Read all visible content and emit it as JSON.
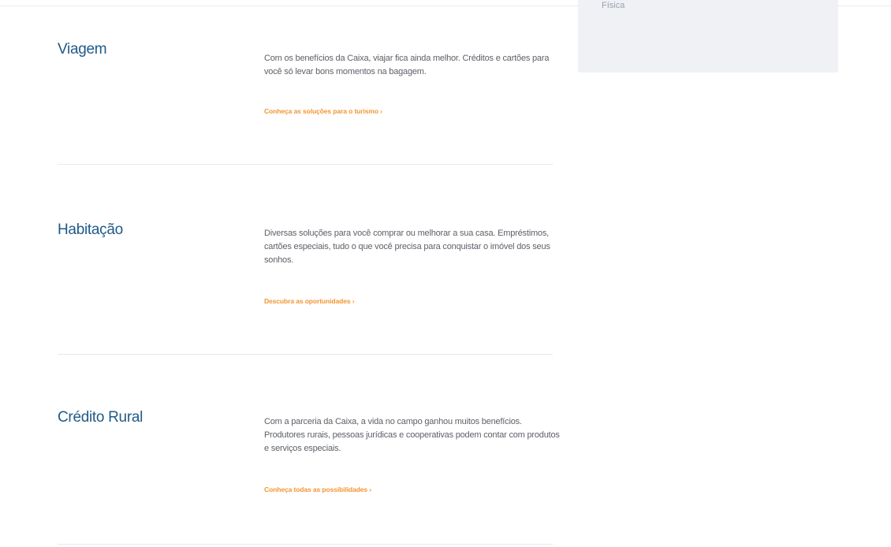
{
  "side_card": {
    "text": "Física"
  },
  "sections": [
    {
      "title": "Viagem",
      "description": "Com os benefícios da Caixa, viajar fica ainda melhor. Créditos e cartões para você só levar bons momentos na bagagem.",
      "link": "Conheça as soluções para o turismo ›"
    },
    {
      "title": "Habitação",
      "description": "Diversas soluções para você comprar ou melhorar a sua casa. Empréstimos, cartões especiais, tudo o que você precisa para conquistar o imóvel dos seus sonhos.",
      "link": "Descubra as oportunidades ›"
    },
    {
      "title": "Crédito Rural",
      "description": "Com a parceria da Caixa, a vida no campo ganhou muitos benefícios. Produtores rurais, pessoas jurídicas e cooperativas podem contar com produtos e serviços especiais.",
      "link": "Conheça todas as possibilidades ›"
    }
  ],
  "colors": {
    "title": "#1f5a88",
    "link": "#f39430",
    "body_text": "#5d6168",
    "card_bg": "#eff1f5"
  }
}
